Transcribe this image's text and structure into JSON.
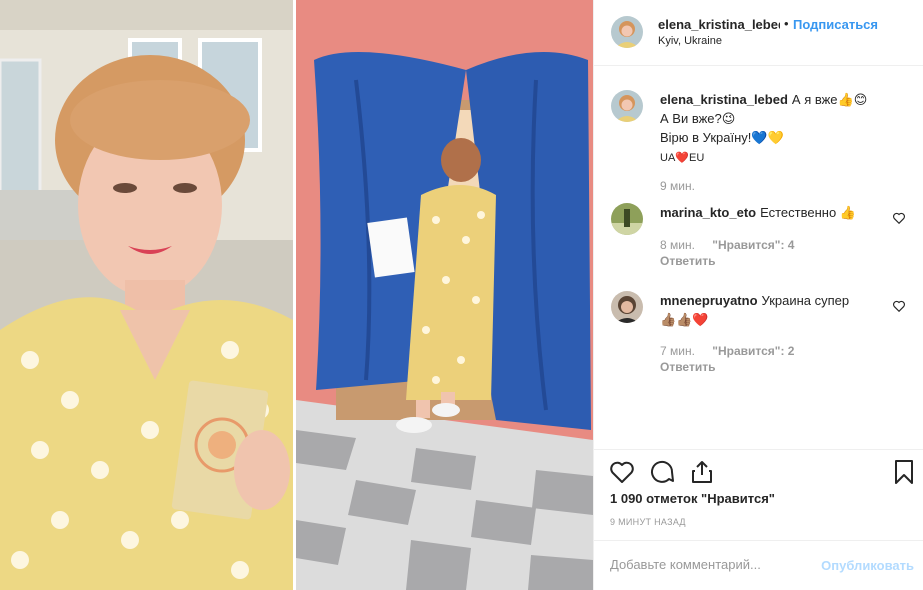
{
  "post": {
    "username": "elena_kristina_lebed",
    "separator": "•",
    "follow_label": "Подписаться",
    "location": "Kyiv, Ukraine"
  },
  "comments": [
    {
      "username": "elena_kristina_lebed",
      "lines": [
        "А я вже👍😊",
        "А Ви вже?😉",
        "Вірю в Україну!💙💛",
        "UA❤️EU"
      ],
      "time": "9 мин."
    },
    {
      "username": "marina_kto_eto",
      "text": "Естественно 👍",
      "time": "8 мин.",
      "likes": "\"Нравится\": 4",
      "reply": "Ответить"
    },
    {
      "username": "mnenepruyatno",
      "text": "Украина супер",
      "text2": "👍🏽👍🏽❤️",
      "time": "7 мин.",
      "likes": "\"Нравится\": 2",
      "reply": "Ответить"
    }
  ],
  "actions": {
    "icons": [
      "heart-outline-icon",
      "comment-bubble-icon",
      "share-upload-icon",
      "bookmark-icon"
    ],
    "likes_count": "1 090 отметок \"Нравится\"",
    "timestamp": "9 МИНУТ НАЗАД"
  },
  "add_comment": {
    "placeholder": "Добавьте комментарий...",
    "publish_label": "Опубликовать"
  },
  "colors": {
    "link_blue": "#3897f0",
    "publish_disabled": "#b3dbff",
    "muted_text": "#999999"
  }
}
